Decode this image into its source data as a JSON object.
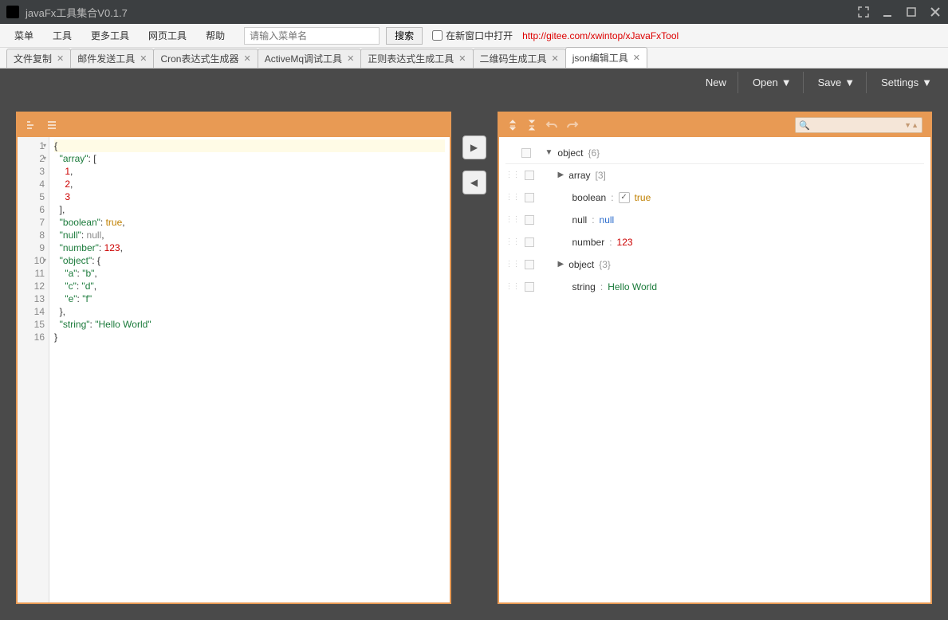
{
  "window": {
    "title": "javaFx工具集合V0.1.7"
  },
  "menubar": {
    "items": [
      "菜单",
      "工具",
      "更多工具",
      "网页工具",
      "帮助"
    ],
    "search_placeholder": "请输入菜单名",
    "search_btn": "搜索",
    "checkbox_label": "在新窗口中打开",
    "url": "http://gitee.com/xwintop/xJavaFxTool"
  },
  "tabs": [
    {
      "label": "文件复制"
    },
    {
      "label": "邮件发送工具"
    },
    {
      "label": "Cron表达式生成器"
    },
    {
      "label": "ActiveMq调试工具"
    },
    {
      "label": "正则表达式生成工具"
    },
    {
      "label": "二维码生成工具"
    },
    {
      "label": "json编辑工具",
      "active": true
    }
  ],
  "toolbar": {
    "new": "New",
    "open": "Open",
    "save": "Save",
    "settings": "Settings"
  },
  "code": {
    "lines": [
      {
        "n": "1",
        "fold": true,
        "html": "{",
        "hl": true
      },
      {
        "n": "2",
        "fold": true,
        "html": "  <span class='k'>\"array\"</span>: ["
      },
      {
        "n": "3",
        "html": "    <span class='n'>1</span>,"
      },
      {
        "n": "4",
        "html": "    <span class='n'>2</span>,"
      },
      {
        "n": "5",
        "html": "    <span class='n'>3</span>"
      },
      {
        "n": "6",
        "html": "  ],"
      },
      {
        "n": "7",
        "html": "  <span class='k'>\"boolean\"</span>: <span class='b'>true</span>,"
      },
      {
        "n": "8",
        "html": "  <span class='k'>\"null\"</span>: <span class='nl'>null</span>,"
      },
      {
        "n": "9",
        "html": "  <span class='k'>\"number\"</span>: <span class='n'>123</span>,"
      },
      {
        "n": "10",
        "fold": true,
        "html": "  <span class='k'>\"object\"</span>: {"
      },
      {
        "n": "11",
        "html": "    <span class='k'>\"a\"</span>: <span class='s'>\"b\"</span>,"
      },
      {
        "n": "12",
        "html": "    <span class='k'>\"c\"</span>: <span class='s'>\"d\"</span>,"
      },
      {
        "n": "13",
        "html": "    <span class='k'>\"e\"</span>: <span class='s'>\"f\"</span>"
      },
      {
        "n": "14",
        "html": "  },"
      },
      {
        "n": "15",
        "html": "  <span class='k'>\"string\"</span>: <span class='s'>\"Hello World\"</span>"
      },
      {
        "n": "16",
        "html": "}"
      }
    ]
  },
  "tree": {
    "root": {
      "key": "object",
      "meta": "{6}"
    },
    "rows": [
      {
        "indent": 1,
        "expand": "▶",
        "key": "array",
        "meta": "[3]"
      },
      {
        "indent": 1,
        "key": "boolean",
        "sep": ":",
        "checkbox": true,
        "val": "true",
        "valcls": "val-bool"
      },
      {
        "indent": 1,
        "key": "null",
        "sep": ":",
        "val": "null",
        "valcls": "val-null"
      },
      {
        "indent": 1,
        "key": "number",
        "sep": ":",
        "val": "123",
        "valcls": "val-num"
      },
      {
        "indent": 1,
        "expand": "▶",
        "key": "object",
        "meta": "{3}"
      },
      {
        "indent": 1,
        "key": "string",
        "sep": ":",
        "val": "Hello World",
        "valcls": "val-str"
      }
    ]
  }
}
